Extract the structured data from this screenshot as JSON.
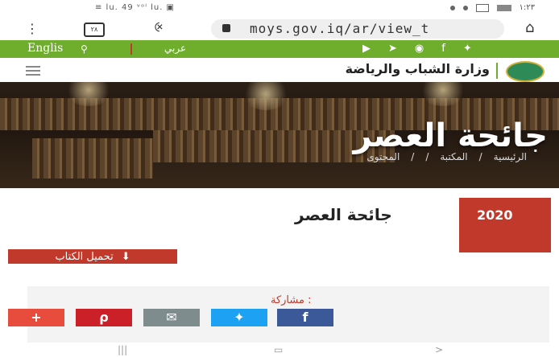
{
  "status_bar": {
    "left_text": "≡ lu. 49 ᵛᵒˡ lu. ▣",
    "right_text": "۱:۲۳"
  },
  "browser": {
    "url": "moys.gov.iq/ar/view_t",
    "tabs_count": "۲۸"
  },
  "green_bar": {
    "english_label": "Englis",
    "arabic_label": "عربي"
  },
  "site_header": {
    "title": "وزارة الشباب والرياضة"
  },
  "banner": {
    "title": "جائحة العصر",
    "breadcrumb": [
      "الرئيسية",
      "/",
      "المكتبة",
      "/",
      "/",
      "المحتوى"
    ]
  },
  "content": {
    "year": "2020",
    "title": "جائحة العصر",
    "download_label": "تحميل الكتاب",
    "share_label": "مشاركة :"
  },
  "share_buttons": [
    {
      "name": "more",
      "glyph": "+",
      "color": "#e74c3c"
    },
    {
      "name": "pinterest",
      "glyph": "℗",
      "color": "#cb2027"
    },
    {
      "name": "email",
      "glyph": "✉",
      "color": "#7f8c8d"
    },
    {
      "name": "twitter",
      "glyph": "✉",
      "color": "#1da1f2"
    },
    {
      "name": "facebook",
      "glyph": "f",
      "color": "#3b5998"
    }
  ],
  "colors": {
    "green": "#6fae2d",
    "red": "#c0392b"
  }
}
